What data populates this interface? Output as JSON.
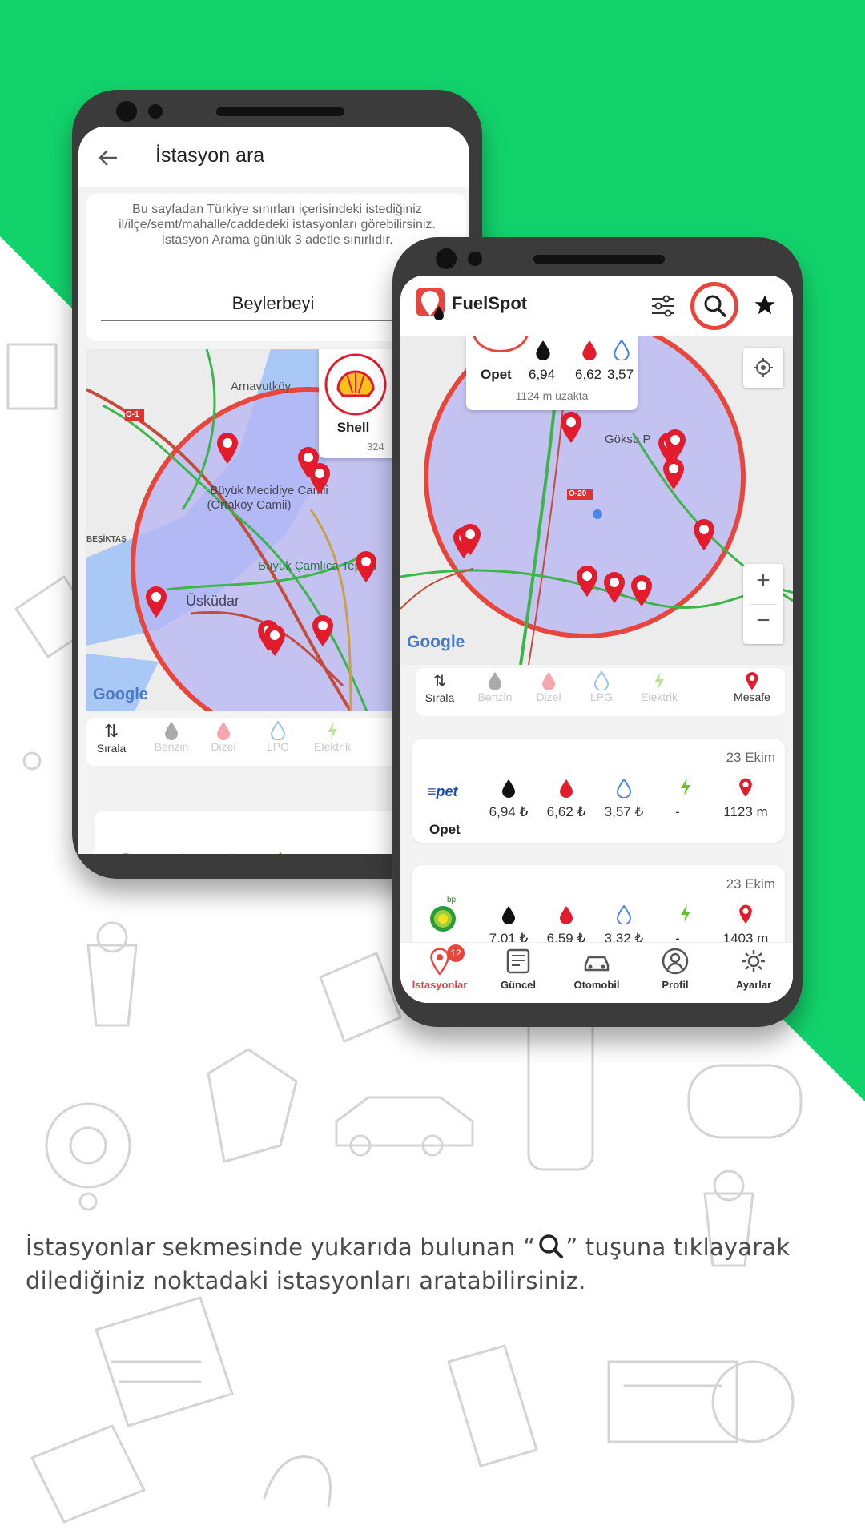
{
  "colors": {
    "brand_green": "#12d36b",
    "accent_red": "#e8453c",
    "pin_red": "#e21b2d",
    "circle_fill": "#b7b4f3",
    "text_dark": "#222222"
  },
  "back_phone": {
    "header": {
      "title": "İstasyon ara",
      "back_icon": "arrow-left-icon"
    },
    "info_text": "Bu sayfadan Türkiye sınırları içerisindeki istediğiniz il/ilçe/semt/mahalle/caddedeki istasyonları görebilirsiniz. İstasyon Arama günlük 3 adetle sınırlıdır.",
    "search_value": "Beylerbeyi",
    "map_labels": {
      "arnavutkoy": "Arnavutköy",
      "mecidiye": "Büyük Mecidiye Camii",
      "ortakoy": "(Ortaköy Camii)",
      "besiktas": "BEŞİKTAŞ",
      "uskudar": "Üsküdar",
      "camlica": "Büyük Çamlıca Tepesi",
      "road": "O-1",
      "google": "Google"
    },
    "popup": {
      "brand": "Shell",
      "distance": "324"
    },
    "filters": [
      {
        "label": "Sırala",
        "icon": "sort-icon",
        "active": true
      },
      {
        "label": "Benzin",
        "icon": "drop-grey-icon",
        "active": false
      },
      {
        "label": "Dizel",
        "icon": "drop-red-icon",
        "active": false
      },
      {
        "label": "LPG",
        "icon": "drop-blue-icon",
        "active": false
      },
      {
        "label": "Elektrik",
        "icon": "bolt-icon",
        "active": false
      }
    ]
  },
  "front_phone": {
    "app_name": "FuelSpot",
    "header_icons": [
      "sliders-icon",
      "search-icon",
      "star-icon"
    ],
    "popup": {
      "brand": "Opet",
      "prices": [
        "6,94",
        "6,62",
        "3,57"
      ],
      "distance": "1124 m uzakta"
    },
    "map_labels": {
      "goksu": "Göksu P",
      "road": "O-20",
      "google": "Google"
    },
    "zoom": {
      "in": "+",
      "out": "−"
    },
    "filters": [
      {
        "label": "Sırala",
        "icon": "sort-icon",
        "active": true
      },
      {
        "label": "Benzin",
        "icon": "drop-grey-icon",
        "active": false
      },
      {
        "label": "Dizel",
        "icon": "drop-red-icon",
        "active": false
      },
      {
        "label": "LPG",
        "icon": "drop-blue-icon",
        "active": false
      },
      {
        "label": "Elektrik",
        "icon": "bolt-icon",
        "active": false
      },
      {
        "label": "Mesafe",
        "icon": "pin-icon",
        "active": true
      }
    ],
    "stations": [
      {
        "name": "Opet",
        "date": "23 Ekim",
        "benzin": "6,94 ₺",
        "dizel": "6,62 ₺",
        "lpg": "3,57 ₺",
        "elektrik": "-",
        "distance": "1123 m"
      },
      {
        "name": "bp",
        "date": "23 Ekim",
        "benzin": "7,01 ₺",
        "dizel": "6,59 ₺",
        "lpg": "3,32 ₺",
        "elektrik": "-",
        "distance": "1403 m"
      }
    ],
    "bottom_nav": [
      {
        "label": "İstasyonlar",
        "icon": "station-pin-icon",
        "badge": "12",
        "active": true
      },
      {
        "label": "Güncel",
        "icon": "news-icon",
        "active": false
      },
      {
        "label": "Otomobil",
        "icon": "car-icon",
        "active": false
      },
      {
        "label": "Profil",
        "icon": "user-icon",
        "active": false
      },
      {
        "label": "Ayarlar",
        "icon": "gear-icon",
        "active": false
      }
    ]
  },
  "caption": {
    "part1": "İstasyonlar sekmesinde yukarıda bulunan “",
    "part2": "” tuşuna tıklayarak",
    "line2": "dilediğiniz noktadaki istasyonları aratabilirsiniz."
  }
}
